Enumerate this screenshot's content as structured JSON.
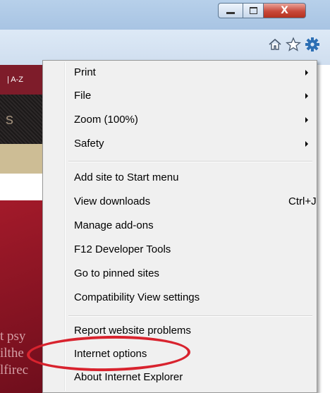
{
  "window": {
    "minimize_label": "",
    "maximize_label": "",
    "close_label": "X"
  },
  "toolbar": {
    "icons": [
      "home-icon",
      "favorites-star-icon",
      "tools-gear-icon"
    ]
  },
  "background_page": {
    "nav_text": "| A-Z",
    "dark_band_text": "s",
    "bottom_text_lines": [
      "t psy",
      "ilthe",
      "lfirec"
    ]
  },
  "menu": {
    "groups": [
      [
        {
          "label": "Print",
          "submenu": true
        },
        {
          "label": "File",
          "submenu": true
        },
        {
          "label": "Zoom (100%)",
          "submenu": true
        },
        {
          "label": "Safety",
          "submenu": true
        }
      ],
      [
        {
          "label": "Add site to Start menu"
        },
        {
          "label": "View downloads",
          "shortcut": "Ctrl+J"
        },
        {
          "label": "Manage add-ons"
        },
        {
          "label": "F12 Developer Tools"
        },
        {
          "label": "Go to pinned sites"
        },
        {
          "label": "Compatibility View settings"
        }
      ],
      [
        {
          "label": "Report website problems"
        },
        {
          "label": "Internet options",
          "highlighted": true
        },
        {
          "label": "About Internet Explorer"
        }
      ]
    ]
  },
  "colors": {
    "highlight_circle": "#d8232e",
    "tools_icon": "#2c6fb4"
  }
}
